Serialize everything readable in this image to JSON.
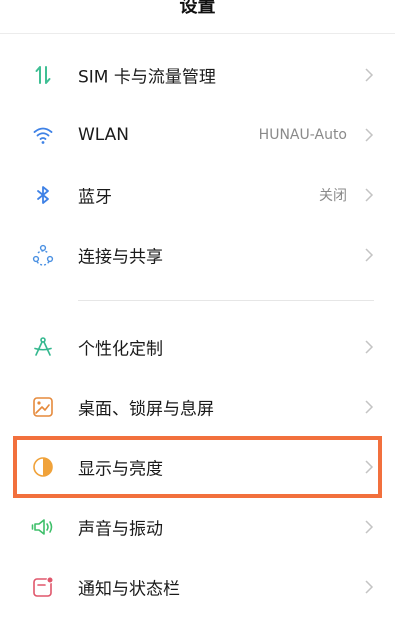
{
  "header": {
    "title": "设置"
  },
  "items": [
    {
      "id": "sim",
      "label": "SIM 卡与流量管理",
      "value": "",
      "icon": "sim-data-icon",
      "icon_color": "#3fbf94"
    },
    {
      "id": "wlan",
      "label": "WLAN",
      "value": "HUNAU-Auto",
      "icon": "wifi-icon",
      "icon_color": "#3f82e6"
    },
    {
      "id": "bluetooth",
      "label": "蓝牙",
      "value": "关闭",
      "icon": "bluetooth-icon",
      "icon_color": "#3f82e6"
    },
    {
      "id": "connect",
      "label": "连接与共享",
      "value": "",
      "icon": "connection-share-icon",
      "icon_color": "#4a90e2"
    },
    {
      "id": "personalize",
      "label": "个性化定制",
      "value": "",
      "icon": "personalize-icon",
      "icon_color": "#35b88f"
    },
    {
      "id": "wallpaper",
      "label": "桌面、锁屏与息屏",
      "value": "",
      "icon": "wallpaper-icon",
      "icon_color": "#e58a3c"
    },
    {
      "id": "display",
      "label": "显示与亮度",
      "value": "",
      "icon": "display-brightness-icon",
      "icon_color": "#f0a23a"
    },
    {
      "id": "sound",
      "label": "声音与振动",
      "value": "",
      "icon": "sound-vibration-icon",
      "icon_color": "#3fbf6a"
    },
    {
      "id": "notify",
      "label": "通知与状态栏",
      "value": "",
      "icon": "notification-statusbar-icon",
      "icon_color": "#e0566b"
    }
  ],
  "highlight": {
    "target": "display",
    "color": "#f2703d"
  }
}
